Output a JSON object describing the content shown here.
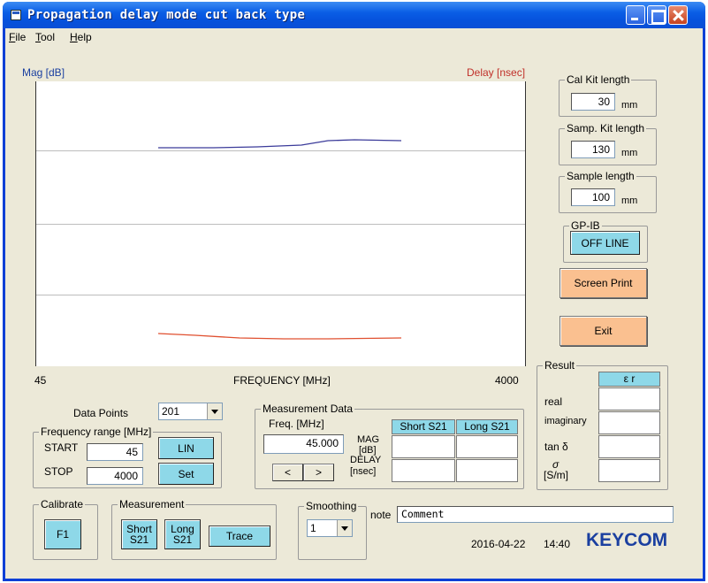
{
  "window": {
    "title": "Propagation delay mode cut back type"
  },
  "menu": [
    {
      "label": "ile",
      "accel": "F"
    },
    {
      "label": "ool",
      "accel": "T"
    },
    {
      "label": "elp",
      "accel": "H"
    }
  ],
  "plot": {
    "left_label": "Mag [dB]",
    "right_label": "Delay [nsec]",
    "x_min": "45",
    "x_max": "4000",
    "x_label": "FREQUENCY [MHz]",
    "colors": {
      "mag": "#3b3b9a",
      "delay": "#e05030",
      "grid": "#bdbdbd"
    }
  },
  "cal_kit": {
    "title": "Cal Kit length",
    "value": "30",
    "unit": "mm"
  },
  "samp_kit": {
    "title": "Samp. Kit length",
    "value": "130",
    "unit": "mm"
  },
  "sample_length": {
    "title": "Sample length",
    "value": "100",
    "unit": "mm"
  },
  "gpib": {
    "title": "GP-IB",
    "button": "OFF LINE"
  },
  "screen_print": "Screen Print",
  "exit": "Exit",
  "data_points": {
    "label": "Data Points",
    "value": "201"
  },
  "freq_range": {
    "title": "Frequency range [MHz]",
    "start_label": "START",
    "start_value": "45",
    "stop_label": "STOP",
    "stop_value": "4000",
    "lin_button": "LIN",
    "set_button": "Set"
  },
  "measurement_data": {
    "title": "Measurement Data",
    "freq_label": "Freq. [MHz]",
    "freq_value": "45.000",
    "mag_label_1": "MAG",
    "mag_label_2": "[dB]",
    "delay_label_1": "DELAY",
    "delay_label_2": "[nsec]",
    "col_short": "Short  S21",
    "col_long": "Long  S21",
    "prev": "<",
    "next": ">"
  },
  "result": {
    "title": "Result",
    "header": "ε r",
    "rows": [
      "real",
      "imaginary",
      "tan δ"
    ],
    "sigma_symbol": "σ",
    "sigma_unit": "[S/m]"
  },
  "calibrate": {
    "title": "Calibrate",
    "button": "F1"
  },
  "measurement": {
    "title": "Measurement",
    "short_1": "Short",
    "short_2": "S21",
    "long_1": "Long",
    "long_2": "S21",
    "trace": "Trace"
  },
  "smoothing": {
    "title": "Smoothing",
    "value": "1"
  },
  "note": {
    "label": "note",
    "value": "Comment"
  },
  "footer": {
    "date": "2016-04-22",
    "time": "14:40",
    "brand": "KEYCOM",
    "brand_color": "#1a3fa0"
  }
}
